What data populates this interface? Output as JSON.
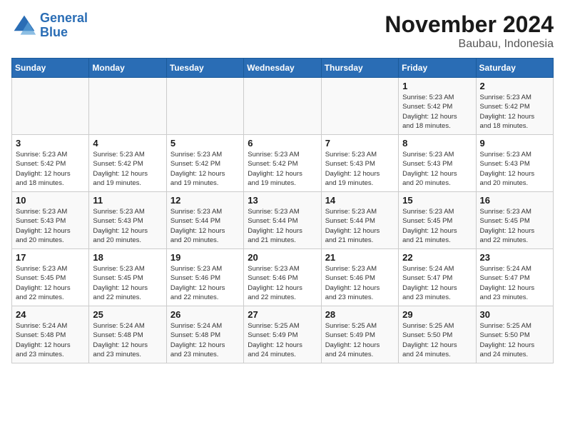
{
  "logo": {
    "line1": "General",
    "line2": "Blue"
  },
  "title": "November 2024",
  "location": "Baubau, Indonesia",
  "weekdays": [
    "Sunday",
    "Monday",
    "Tuesday",
    "Wednesday",
    "Thursday",
    "Friday",
    "Saturday"
  ],
  "weeks": [
    [
      {
        "day": "",
        "info": ""
      },
      {
        "day": "",
        "info": ""
      },
      {
        "day": "",
        "info": ""
      },
      {
        "day": "",
        "info": ""
      },
      {
        "day": "",
        "info": ""
      },
      {
        "day": "1",
        "info": "Sunrise: 5:23 AM\nSunset: 5:42 PM\nDaylight: 12 hours\nand 18 minutes."
      },
      {
        "day": "2",
        "info": "Sunrise: 5:23 AM\nSunset: 5:42 PM\nDaylight: 12 hours\nand 18 minutes."
      }
    ],
    [
      {
        "day": "3",
        "info": "Sunrise: 5:23 AM\nSunset: 5:42 PM\nDaylight: 12 hours\nand 18 minutes."
      },
      {
        "day": "4",
        "info": "Sunrise: 5:23 AM\nSunset: 5:42 PM\nDaylight: 12 hours\nand 19 minutes."
      },
      {
        "day": "5",
        "info": "Sunrise: 5:23 AM\nSunset: 5:42 PM\nDaylight: 12 hours\nand 19 minutes."
      },
      {
        "day": "6",
        "info": "Sunrise: 5:23 AM\nSunset: 5:42 PM\nDaylight: 12 hours\nand 19 minutes."
      },
      {
        "day": "7",
        "info": "Sunrise: 5:23 AM\nSunset: 5:43 PM\nDaylight: 12 hours\nand 19 minutes."
      },
      {
        "day": "8",
        "info": "Sunrise: 5:23 AM\nSunset: 5:43 PM\nDaylight: 12 hours\nand 20 minutes."
      },
      {
        "day": "9",
        "info": "Sunrise: 5:23 AM\nSunset: 5:43 PM\nDaylight: 12 hours\nand 20 minutes."
      }
    ],
    [
      {
        "day": "10",
        "info": "Sunrise: 5:23 AM\nSunset: 5:43 PM\nDaylight: 12 hours\nand 20 minutes."
      },
      {
        "day": "11",
        "info": "Sunrise: 5:23 AM\nSunset: 5:43 PM\nDaylight: 12 hours\nand 20 minutes."
      },
      {
        "day": "12",
        "info": "Sunrise: 5:23 AM\nSunset: 5:44 PM\nDaylight: 12 hours\nand 20 minutes."
      },
      {
        "day": "13",
        "info": "Sunrise: 5:23 AM\nSunset: 5:44 PM\nDaylight: 12 hours\nand 21 minutes."
      },
      {
        "day": "14",
        "info": "Sunrise: 5:23 AM\nSunset: 5:44 PM\nDaylight: 12 hours\nand 21 minutes."
      },
      {
        "day": "15",
        "info": "Sunrise: 5:23 AM\nSunset: 5:45 PM\nDaylight: 12 hours\nand 21 minutes."
      },
      {
        "day": "16",
        "info": "Sunrise: 5:23 AM\nSunset: 5:45 PM\nDaylight: 12 hours\nand 22 minutes."
      }
    ],
    [
      {
        "day": "17",
        "info": "Sunrise: 5:23 AM\nSunset: 5:45 PM\nDaylight: 12 hours\nand 22 minutes."
      },
      {
        "day": "18",
        "info": "Sunrise: 5:23 AM\nSunset: 5:45 PM\nDaylight: 12 hours\nand 22 minutes."
      },
      {
        "day": "19",
        "info": "Sunrise: 5:23 AM\nSunset: 5:46 PM\nDaylight: 12 hours\nand 22 minutes."
      },
      {
        "day": "20",
        "info": "Sunrise: 5:23 AM\nSunset: 5:46 PM\nDaylight: 12 hours\nand 22 minutes."
      },
      {
        "day": "21",
        "info": "Sunrise: 5:23 AM\nSunset: 5:46 PM\nDaylight: 12 hours\nand 23 minutes."
      },
      {
        "day": "22",
        "info": "Sunrise: 5:24 AM\nSunset: 5:47 PM\nDaylight: 12 hours\nand 23 minutes."
      },
      {
        "day": "23",
        "info": "Sunrise: 5:24 AM\nSunset: 5:47 PM\nDaylight: 12 hours\nand 23 minutes."
      }
    ],
    [
      {
        "day": "24",
        "info": "Sunrise: 5:24 AM\nSunset: 5:48 PM\nDaylight: 12 hours\nand 23 minutes."
      },
      {
        "day": "25",
        "info": "Sunrise: 5:24 AM\nSunset: 5:48 PM\nDaylight: 12 hours\nand 23 minutes."
      },
      {
        "day": "26",
        "info": "Sunrise: 5:24 AM\nSunset: 5:48 PM\nDaylight: 12 hours\nand 23 minutes."
      },
      {
        "day": "27",
        "info": "Sunrise: 5:25 AM\nSunset: 5:49 PM\nDaylight: 12 hours\nand 24 minutes."
      },
      {
        "day": "28",
        "info": "Sunrise: 5:25 AM\nSunset: 5:49 PM\nDaylight: 12 hours\nand 24 minutes."
      },
      {
        "day": "29",
        "info": "Sunrise: 5:25 AM\nSunset: 5:50 PM\nDaylight: 12 hours\nand 24 minutes."
      },
      {
        "day": "30",
        "info": "Sunrise: 5:25 AM\nSunset: 5:50 PM\nDaylight: 12 hours\nand 24 minutes."
      }
    ]
  ]
}
